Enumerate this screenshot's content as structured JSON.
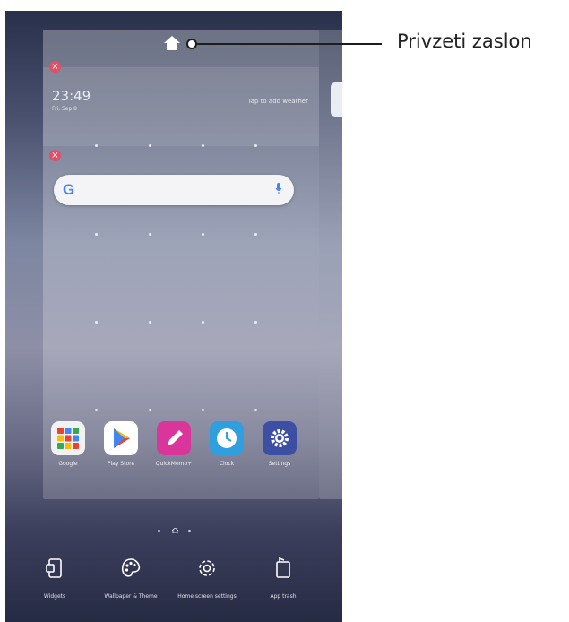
{
  "annotation": {
    "label": "Privzeti zaslon"
  },
  "weather_widget": {
    "time": "23:49",
    "date": "Fri, Sep 8",
    "hint": "Tap to add weather"
  },
  "search_widget": {
    "logo": "G",
    "mic": "mic-icon"
  },
  "dock_apps": [
    {
      "label": "Google",
      "icon": "folder-icon",
      "color": "#f2f2f2"
    },
    {
      "label": "Play Store",
      "icon": "play-store-icon",
      "color": "#ffffff"
    },
    {
      "label": "QuickMemo+",
      "icon": "pencil-icon",
      "color": "#d9359a"
    },
    {
      "label": "Clock",
      "icon": "clock-icon",
      "color": "#2f9fe0"
    },
    {
      "label": "Settings",
      "icon": "gear-icon",
      "color": "#3d4fa3"
    }
  ],
  "bottom_bar": [
    {
      "label": "Widgets",
      "icon": "widgets-icon"
    },
    {
      "label": "Wallpaper & Theme",
      "icon": "palette-icon"
    },
    {
      "label": "Home screen settings",
      "icon": "gear-icon"
    },
    {
      "label": "App trash",
      "icon": "trash-icon"
    }
  ],
  "colors": {
    "remove": "#e0506a",
    "accent": "#4285f4"
  }
}
